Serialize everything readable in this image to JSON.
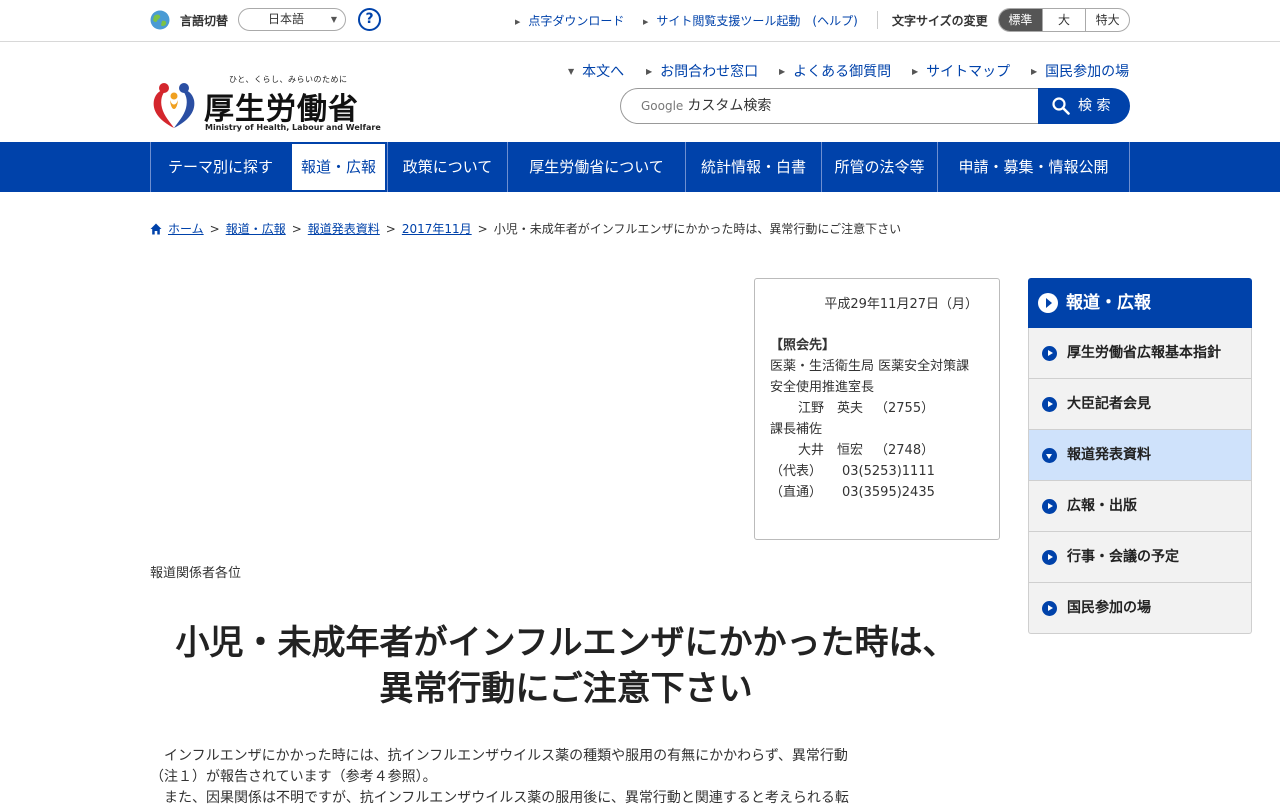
{
  "utility": {
    "language_label": "言語切替",
    "language_value": "日本語",
    "help_symbol": "?",
    "links": [
      "点字ダウンロード",
      "サイト閲覧支援ツール起動　(ヘルプ)"
    ],
    "font_size_label": "文字サイズの変更",
    "font_sizes": [
      "標準",
      "大",
      "特大"
    ]
  },
  "header": {
    "logo_tagline": "ひと、くらし、みらいのために",
    "logo_name": "厚生労働省",
    "logo_english": "Ministry of Health, Labour and Welfare",
    "links": [
      "本文へ",
      "お問合わせ窓口",
      "よくある御質問",
      "サイトマップ",
      "国民参加の場"
    ],
    "search_brand": "Google",
    "search_placeholder": "カスタム検索",
    "search_button": "検 索"
  },
  "nav": {
    "items": [
      "テーマ別に探す",
      "報道・広報",
      "政策について",
      "厚生労働省について",
      "統計情報・白書",
      "所管の法令等",
      "申請・募集・情報公開"
    ]
  },
  "breadcrumb": {
    "items": [
      "ホーム",
      "報道・広報",
      "報道発表資料",
      "2017年11月"
    ],
    "current": "小児・未成年者がインフルエンザにかかった時は、異常行動にご注意下さい",
    "separator": ">"
  },
  "contact": {
    "date": "平成29年11月27日（月）",
    "title": "【照会先】",
    "dept": "医薬・生活衛生局 医薬安全対策課",
    "office": "安全使用推進室長",
    "person1_name": "江野　英夫",
    "person1_ext": "（2755）",
    "role2": "課長補佐",
    "person2_name": "大井　恒宏",
    "person2_ext": "（2748）",
    "rep_label": "（代表）",
    "rep_tel": "03(5253)1111",
    "direct_label": "（直通）",
    "direct_tel": "03(3595)2435"
  },
  "article": {
    "addressee": "報道関係者各位",
    "headline_line1": "小児・未成年者がインフルエンザにかかった時は、",
    "headline_line2": "異常行動にご注意下さい",
    "paragraph1_line1": "　インフルエンザにかかった時には、抗インフルエンザウイルス薬の種類や服用の有無にかかわらず、異常行動",
    "paragraph1_line2": "（注１）が報告されています（参考４参照）。",
    "paragraph2_line1": "　また、因果関係は不明ですが、抗インフルエンザウイルス薬の服用後に、異常行動と関連すると考えられる転"
  },
  "sidebar": {
    "title": "報道・広報",
    "items": [
      "厚生労働省広報基本指針",
      "大臣記者会見",
      "報道発表資料",
      "広報・出版",
      "行事・会議の予定",
      "国民参加の場"
    ],
    "current_index": 2
  },
  "colors": {
    "brand_blue": "#0042aa",
    "sidebar_current_bg": "#cfe2fb",
    "sidebar_item_bg": "#f2f2f2"
  }
}
